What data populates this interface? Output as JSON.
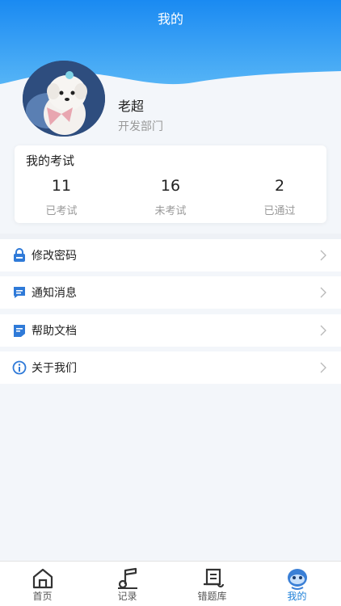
{
  "header": {
    "title": "我的"
  },
  "profile": {
    "name": "老超",
    "department": "开发部门"
  },
  "exam": {
    "title": "我的考试",
    "stats": [
      {
        "value": "11",
        "label": "已考试"
      },
      {
        "value": "16",
        "label": "未考试"
      },
      {
        "value": "2",
        "label": "已通过"
      }
    ]
  },
  "menu": [
    {
      "label": "修改密码",
      "icon": "lock-icon"
    },
    {
      "label": "通知消息",
      "icon": "message-icon"
    },
    {
      "label": "帮助文档",
      "icon": "document-icon"
    },
    {
      "label": "关于我们",
      "icon": "info-icon"
    }
  ],
  "tabs": [
    {
      "label": "首页",
      "icon": "home-icon"
    },
    {
      "label": "记录",
      "icon": "record-icon"
    },
    {
      "label": "错题库",
      "icon": "scroll-icon"
    },
    {
      "label": "我的",
      "icon": "profile-icon",
      "active": true
    }
  ],
  "colors": {
    "accent": "#1b7fd8",
    "header_top": "#1e8ff2",
    "header_bottom": "#4aaef5"
  }
}
